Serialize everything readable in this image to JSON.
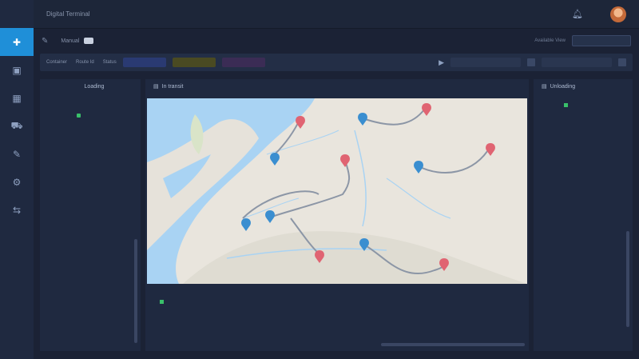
{
  "topbar": {
    "title": "Digital Terminal",
    "user_line1": "",
    "user_line2": ""
  },
  "toolbar": {
    "label": "Manual",
    "hint": "Available View",
    "button": ""
  },
  "filters": {
    "f1_label": "Container",
    "f1_value": "",
    "f2_label": "Route Id",
    "f2_value": "",
    "f3_label": "Status",
    "chips": [
      "",
      "",
      ""
    ]
  },
  "loading": {
    "title": "Loading",
    "entries": [
      {
        "num": "",
        "lines": [
          {
            "text": "",
            "style": "orange"
          },
          {
            "text": "",
            "style": "white",
            "dot": true
          },
          {
            "text": "",
            "style": "white"
          }
        ]
      },
      {
        "num": "",
        "lines": [
          {
            "text": "",
            "style": "orange"
          },
          {
            "text": "",
            "style": "yellowbg"
          },
          {
            "text": "",
            "style": "white"
          }
        ]
      },
      {
        "num": "",
        "lines": [
          {
            "text": "",
            "style": "orange"
          },
          {
            "text": "",
            "style": "white"
          },
          {
            "text": "",
            "style": "red"
          },
          {
            "text": "",
            "style": "white"
          },
          {
            "text": "",
            "style": "white"
          }
        ]
      },
      {
        "num": "",
        "lines": [
          {
            "text": "",
            "style": "bluet"
          },
          {
            "text": "",
            "style": "white"
          },
          {
            "text": "",
            "style": "yellowbg"
          },
          {
            "text": "",
            "style": "white"
          },
          {
            "text": "",
            "style": "red"
          }
        ]
      }
    ]
  },
  "map": {
    "title": "In transit"
  },
  "cards": [
    {
      "a": "",
      "b": "",
      "c": "",
      "dot": true
    },
    {
      "a": "",
      "b": "",
      "c": ""
    },
    {
      "a": "",
      "b": "",
      "c": ""
    },
    {
      "a": "",
      "b": "",
      "c": ""
    },
    {
      "a": "",
      "b": "",
      "c": ""
    }
  ],
  "unloading": {
    "title": "Unloading",
    "groups": [
      {
        "name": "",
        "rows": [
          {
            "t": "",
            "k": "w"
          },
          {
            "t": "",
            "k": "b",
            "dot": true
          },
          {
            "t": "",
            "k": "b"
          },
          {
            "t": "",
            "k": "w"
          },
          {
            "t": "",
            "k": "b"
          }
        ]
      },
      {
        "name": "",
        "rows": [
          {
            "t": "",
            "k": "w"
          },
          {
            "t": "",
            "k": "b"
          }
        ]
      },
      {
        "name": "",
        "rows": [
          {
            "t": "",
            "k": "w"
          },
          {
            "t": "",
            "k": "b"
          },
          {
            "t": "",
            "k": "b"
          }
        ]
      },
      {
        "name": "",
        "rows": [
          {
            "t": "",
            "k": "w"
          },
          {
            "t": "",
            "k": "b"
          },
          {
            "t": "",
            "k": "w"
          },
          {
            "t": "",
            "k": "b"
          }
        ]
      }
    ]
  },
  "colors": {
    "accent": "#1f8fd8",
    "panel": "#1f2940",
    "background": "#1b2235"
  },
  "icons": {
    "rail": [
      "plus-icon",
      "camera-icon",
      "grid-icon",
      "truck-icon",
      "tag-icon",
      "gear-icon",
      "share-icon"
    ]
  }
}
